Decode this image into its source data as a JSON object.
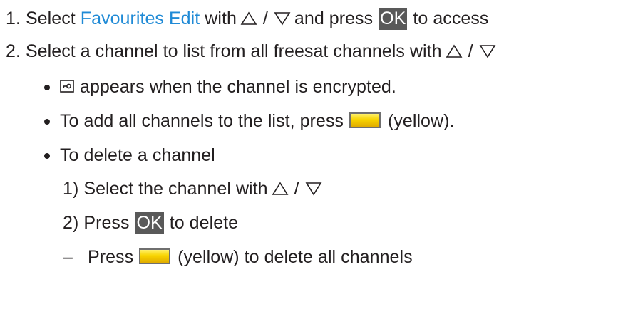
{
  "steps": [
    {
      "number": "1.",
      "text_select": "Select",
      "link": "Favourites Edit",
      "text_with": "with",
      "separator": "/",
      "text_and_press": "and press",
      "ok_label": "OK",
      "text_end": "to access"
    },
    {
      "number": "2.",
      "text": "Select a channel to list from all freesat channels with",
      "separator": "/"
    }
  ],
  "bullets": {
    "encrypted": "appears when the channel is encrypted.",
    "add_all_before": "To add all channels to the list, press",
    "add_all_after": "(yellow).",
    "delete_heading": "To delete a channel"
  },
  "sub_steps": [
    {
      "number": "1)",
      "text": "Select the channel with",
      "separator": "/"
    },
    {
      "number": "2)",
      "text_press": "Press",
      "ok_label": "OK",
      "text_end": "to delete"
    }
  ],
  "dash_item": {
    "dash": "–",
    "text_press": "Press",
    "text_end": "(yellow) to delete all channels"
  },
  "icons": {
    "up": "up-triangle-icon",
    "down": "down-triangle-icon",
    "lock": "encrypted-lock-icon",
    "yellow": "yellow-button-icon"
  },
  "colors": {
    "text": "#231f20",
    "link": "#1f8ad6",
    "ok_bg": "#595959",
    "ok_text": "#ffffff",
    "yellow": "#f8d400"
  }
}
